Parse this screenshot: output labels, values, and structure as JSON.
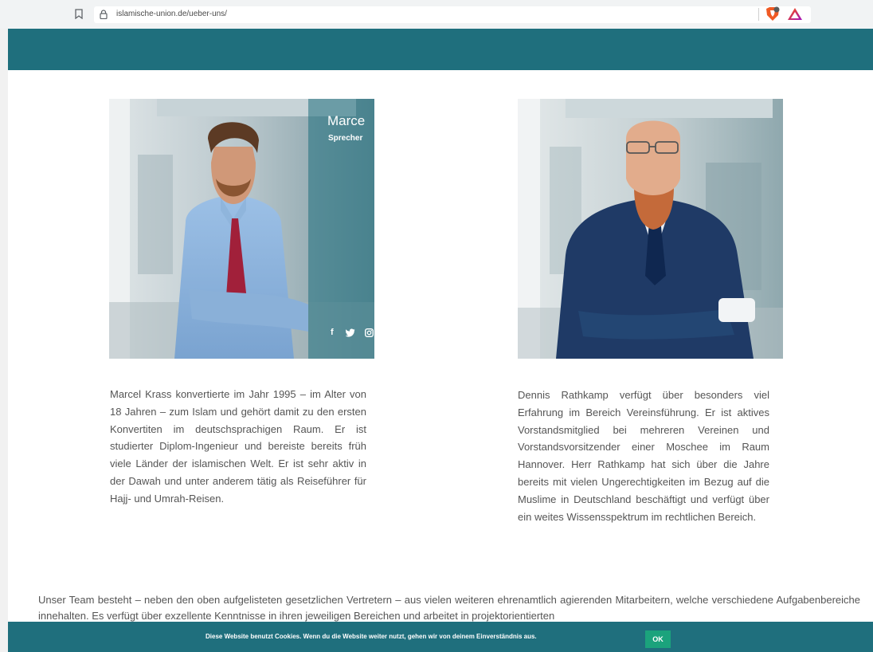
{
  "browser": {
    "url": "islamische-union.de/ueber-uns/",
    "icons": [
      "bookmark-icon",
      "lock-icon",
      "brave-shield-icon",
      "brave-rewards-icon"
    ]
  },
  "colors": {
    "header": "#1f6f7d",
    "cookie_bar": "#1f6f7d",
    "ok_button": "#1ba37c",
    "body_text": "#555555"
  },
  "team": {
    "members": [
      {
        "overlay_name": "Marce",
        "overlay_role": "Sprecher",
        "social_icons": [
          "facebook-icon",
          "twitter-icon",
          "instagram-icon"
        ],
        "bio": "Marcel Krass konvertierte im Jahr 1995 – im Alter von 18 Jahren – zum Islam und gehört damit zu den ersten Konvertiten im deutschsprachigen Raum. Er ist studierter Diplom-Ingenieur und bereiste bereits früh viele Länder der islamischen Welt. Er ist sehr aktiv in der Dawah und unter anderem tätig als Reiseführer für Hajj- und Umrah-Reisen."
      },
      {
        "bio": "Dennis Rathkamp verfügt über besonders viel Erfahrung im Bereich Vereinsführung. Er ist aktives Vorstandsmitglied bei mehreren Vereinen und Vorstandsvorsitzender einer Moschee im Raum Hannover. Herr Rathkamp hat sich über die Jahre bereits mit vielen Ungerechtigkeiten im Bezug auf die Muslime in Deutschland beschäftigt und verfügt über ein weites Wissensspektrum im rechtlichen Bereich."
      }
    ],
    "paragraph": "Unser Team besteht – neben den oben aufgelisteten gesetzlichen Vertretern – aus vielen weiteren ehrenamtlich agierenden Mitarbeitern, welche verschiedene Aufgabenbereiche innehalten. Es verfügt über exzellente Kenntnisse in ihren jeweiligen Bereichen und arbeitet in projektorientierten"
  },
  "cookie": {
    "message": "Diese Website benutzt Cookies. Wenn du die Website weiter nutzt, gehen wir von deinem Einverständnis aus.",
    "ok_label": "OK"
  }
}
